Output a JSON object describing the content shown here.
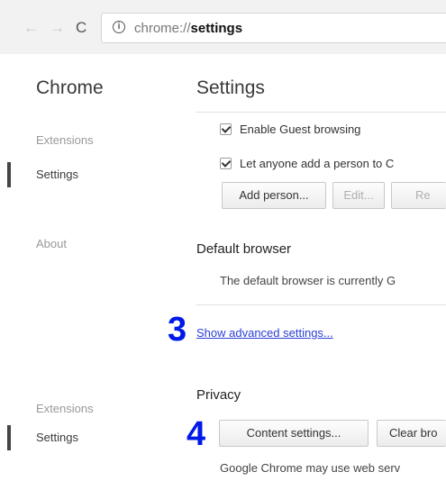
{
  "browser": {
    "back_glyph": "←",
    "forward_glyph": "→",
    "reload_glyph": "C",
    "url_scheme": "chrome://",
    "url_host": "settings"
  },
  "sidebar": {
    "title": "Chrome",
    "items": [
      {
        "label": "Extensions"
      },
      {
        "label": "Settings"
      },
      {
        "label": "About"
      },
      {
        "label": "Extensions"
      },
      {
        "label": "Settings"
      }
    ]
  },
  "main": {
    "title": "Settings",
    "people": {
      "guest_label": "Enable Guest browsing",
      "anyone_add_label": "Let anyone add a person to C",
      "add_person": "Add person...",
      "edit": "Edit...",
      "remove": "Re"
    },
    "default_browser": {
      "heading": "Default browser",
      "text": "The default browser is currently G"
    },
    "advanced_link": "Show advanced settings...",
    "privacy": {
      "heading": "Privacy",
      "content_settings": "Content settings...",
      "clear_browsing": "Clear bro",
      "text": "Google Chrome may use web serv"
    }
  },
  "annotations": {
    "step3": "3",
    "step4": "4"
  },
  "colors": {
    "annotation": "#0019e8",
    "link": "#2a3fd6"
  }
}
